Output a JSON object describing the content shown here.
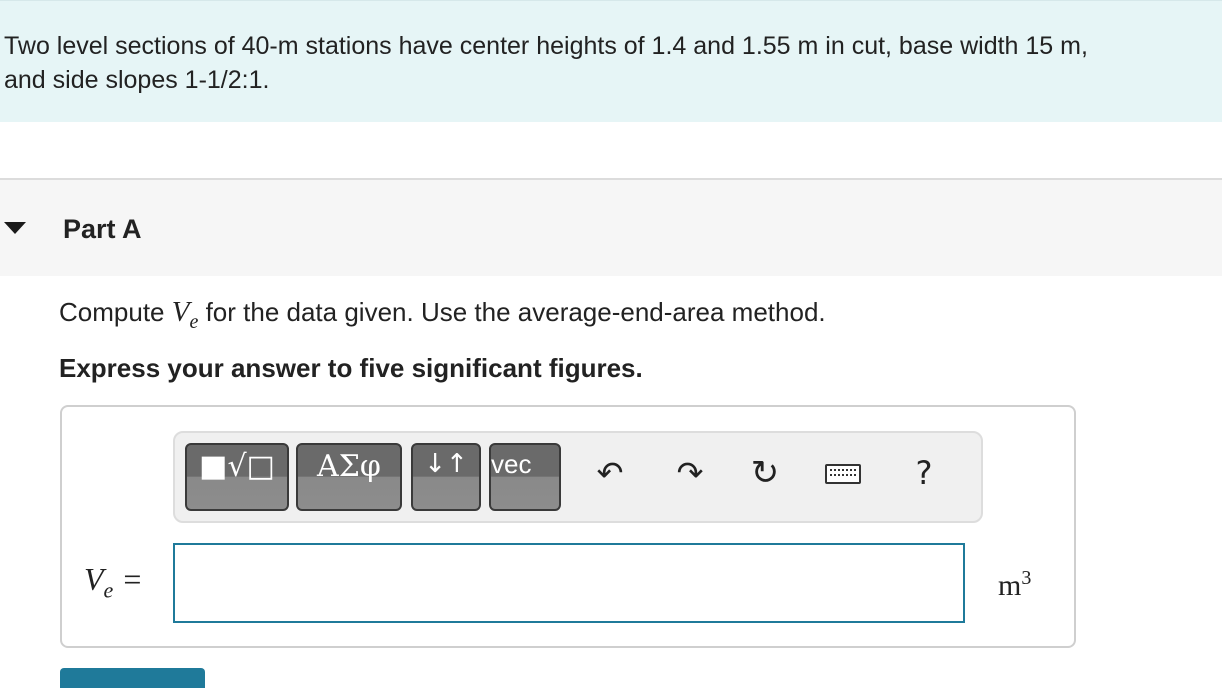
{
  "problem": {
    "line1": "Two level sections of 40-m stations have center heights of 1.4 and 1.55 m in cut, base width 15 m,",
    "line2": "and side slopes 1-1/2:1."
  },
  "part": {
    "title": "Part A"
  },
  "question": {
    "prefix": "Compute",
    "var": "V",
    "var_sub": "e",
    "suffix": "for the data given. Use the average-end-area method.",
    "instruction": "Express your answer to five significant figures."
  },
  "toolbar": {
    "templates_label": "■√□",
    "greek_label": "ΑΣφ",
    "arrows_label": "↓↑",
    "vec_label": "vec",
    "undo_glyph": "↶",
    "redo_glyph": "↷",
    "reset_glyph": "↻",
    "help_label": "?"
  },
  "answer": {
    "var": "V",
    "var_sub": "e",
    "equals": "=",
    "value": "",
    "unit": "m",
    "unit_exp": "3"
  },
  "colors": {
    "banner_bg": "#e6f5f6",
    "accent": "#1f7a9a"
  }
}
